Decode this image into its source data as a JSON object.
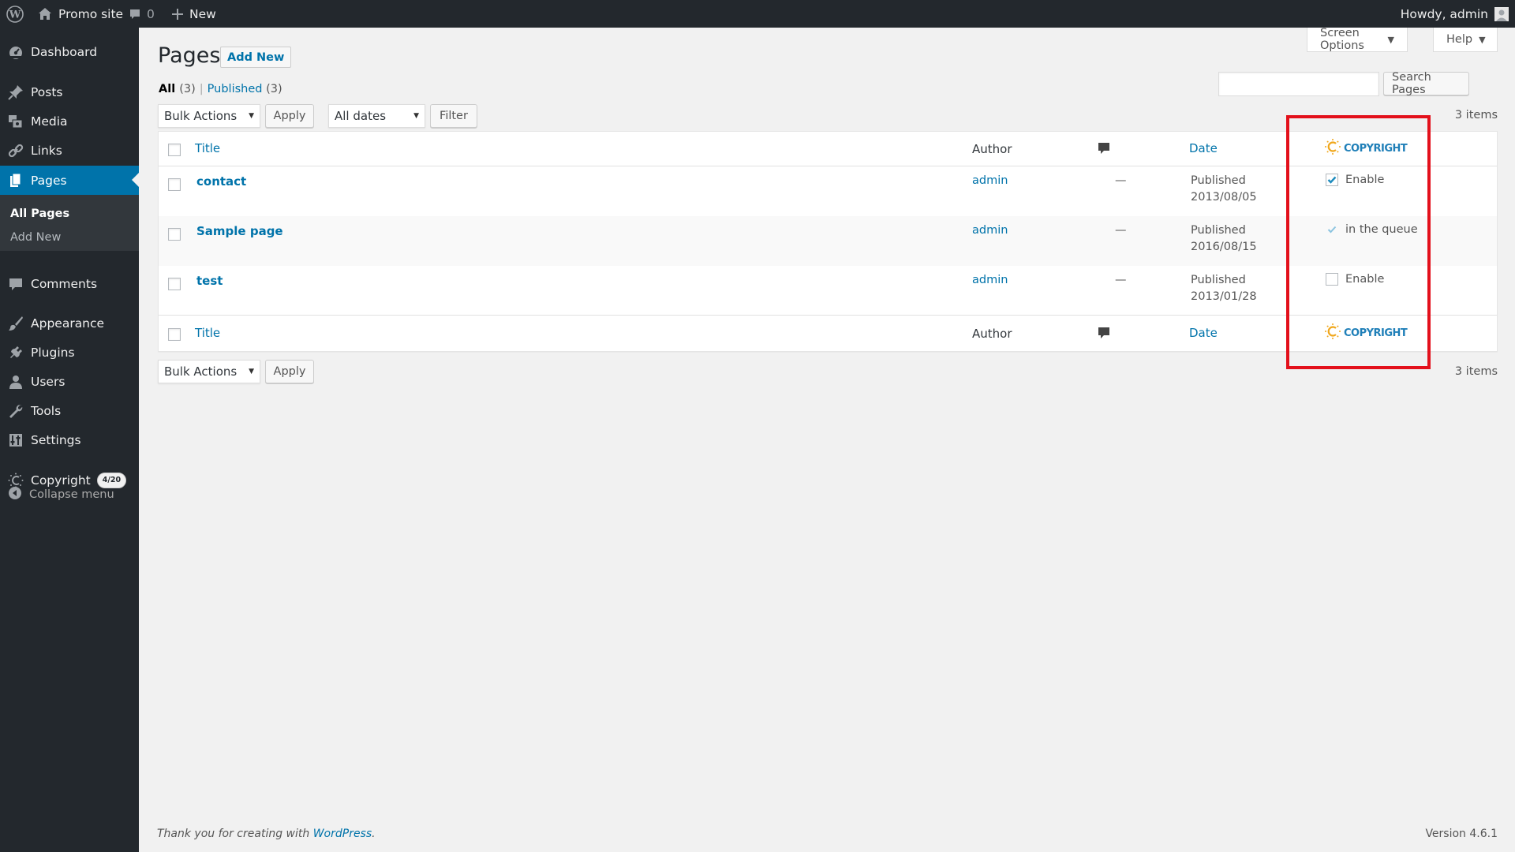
{
  "adminbar": {
    "site_name": "Promo site",
    "comments_count": "0",
    "new_label": "New",
    "howdy": "Howdy, admin"
  },
  "sidebar": {
    "items": [
      {
        "label": "Dashboard",
        "icon": "dashboard-icon"
      },
      {
        "label": "Posts",
        "icon": "pin-icon"
      },
      {
        "label": "Media",
        "icon": "media-icon"
      },
      {
        "label": "Links",
        "icon": "link-icon"
      },
      {
        "label": "Pages",
        "icon": "page-icon"
      },
      {
        "label": "Comments",
        "icon": "comment-icon"
      },
      {
        "label": "Appearance",
        "icon": "brush-icon"
      },
      {
        "label": "Plugins",
        "icon": "plug-icon"
      },
      {
        "label": "Users",
        "icon": "user-icon"
      },
      {
        "label": "Tools",
        "icon": "wrench-icon"
      },
      {
        "label": "Settings",
        "icon": "settings-icon"
      },
      {
        "label": "Copyright",
        "icon": "copyright-icon",
        "badge": "4/20"
      }
    ],
    "submenu": {
      "all_pages": "All Pages",
      "add_new": "Add New"
    },
    "collapse": "Collapse menu",
    "current": "Pages"
  },
  "screen_meta": {
    "screen_options": "Screen Options",
    "help": "Help"
  },
  "page": {
    "title": "Pages",
    "add_new": "Add New",
    "filters": {
      "all": "All",
      "all_count": "(3)",
      "published": "Published",
      "published_count": "(3)"
    },
    "search": {
      "value": "",
      "button": "Search Pages"
    },
    "bulk_actions": "Bulk Actions",
    "apply": "Apply",
    "all_dates": "All dates",
    "filter": "Filter",
    "items_count": "3 items"
  },
  "table": {
    "columns": {
      "title": "Title",
      "author": "Author",
      "date": "Date",
      "copyright": "COPYRIGHT"
    },
    "rows": [
      {
        "title": "contact",
        "author": "admin",
        "comments": "—",
        "status": "Published",
        "date": "2013/08/05",
        "copyright_label": "Enable",
        "copyright_state": "checked"
      },
      {
        "title": "Sample page",
        "author": "admin",
        "comments": "—",
        "status": "Published",
        "date": "2016/08/15",
        "copyright_label": "in the queue",
        "copyright_state": "queued"
      },
      {
        "title": "test",
        "author": "admin",
        "comments": "—",
        "status": "Published",
        "date": "2013/01/28",
        "copyright_label": "Enable",
        "copyright_state": "unchecked"
      }
    ]
  },
  "footer": {
    "thanks_prefix": "Thank you for creating with ",
    "wp_link": "WordPress",
    "thanks_suffix": ".",
    "version": "Version 4.6.1"
  },
  "colors": {
    "adminbar_bg": "#23282d",
    "accent": "#0073aa",
    "highlight": "#e3101b",
    "copyright_orange": "#f0a71c",
    "copyright_blue": "#1f7fb8"
  }
}
